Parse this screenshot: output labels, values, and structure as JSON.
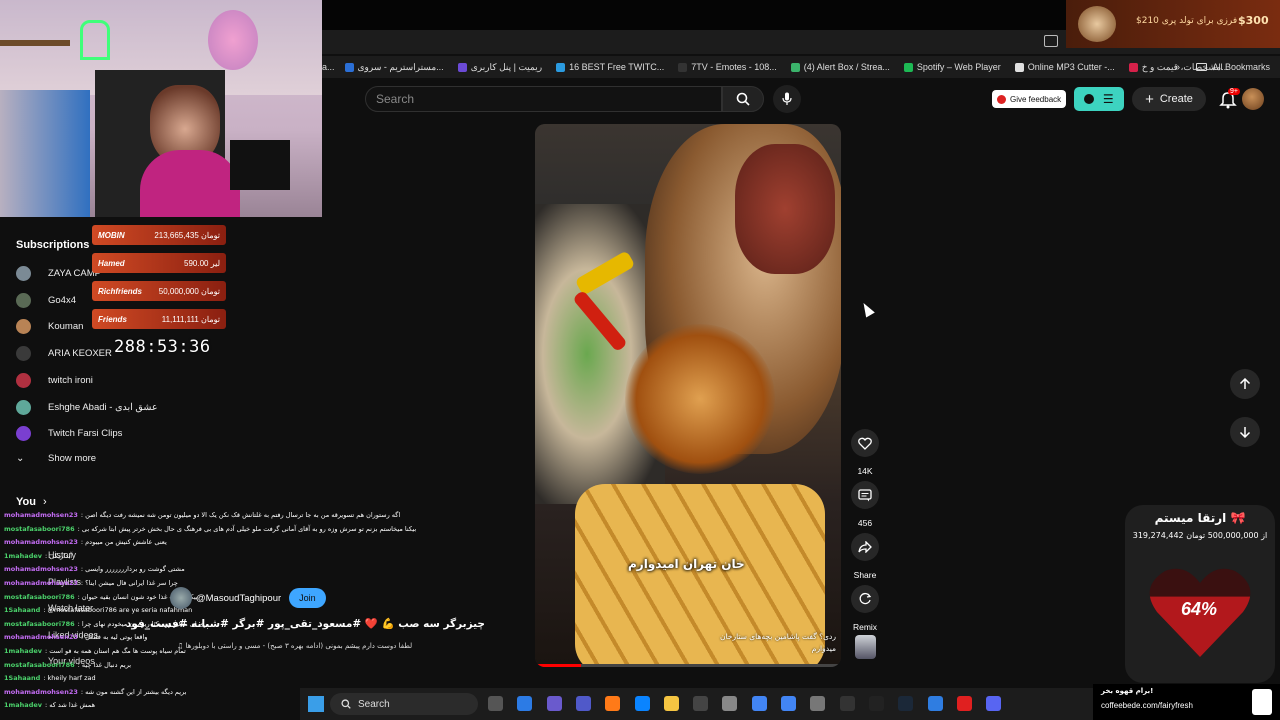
{
  "browser": {
    "bookmarks": [
      {
        "label": "مستراستریم - سروی...",
        "color": "#2b6fd6"
      },
      {
        "label": "ریمیت | پنل کاربری",
        "color": "#6b4ad6"
      },
      {
        "label": "16 BEST Free TWITC...",
        "color": "#2b9be0"
      },
      {
        "label": "7TV - Emotes - 108...",
        "color": "#333333"
      },
      {
        "label": "(4) Alert Box / Strea...",
        "color": "#3bb36b"
      },
      {
        "label": "Spotify – Web Player",
        "color": "#1db954"
      },
      {
        "label": "Online MP3 Cutter -...",
        "color": "#e0e0e0"
      },
      {
        "label": "مشخصات، قیمت و خ...",
        "color": "#d6214a"
      }
    ],
    "all_bookmarks": "All Bookmarks"
  },
  "header": {
    "search_placeholder": "Search",
    "feedback_label": "Give feedback",
    "create_label": "Create",
    "notif_count": "9+"
  },
  "sidebar": {
    "subscriptions_title": "Subscriptions",
    "subscriptions": [
      {
        "label": "ZAYA CAMP",
        "color": "#7b8a95"
      },
      {
        "label": "Go4x4",
        "color": "#5a6a55"
      },
      {
        "label": "Kouman",
        "color": "#b88355"
      },
      {
        "label": "ARIA KEOXER",
        "color": "#3a3a3a"
      },
      {
        "label": "twitch ironi",
        "color": "#b03040"
      },
      {
        "label": "Eshghe Abadi - عشق ابدی",
        "color": "#5fa89a"
      },
      {
        "label": "Twitch Farsi Clips",
        "color": "#7a3fd0"
      }
    ],
    "show_more": "Show more",
    "you_title": "You",
    "you_items": [
      "History",
      "Playlists",
      "Watch later",
      "Liked videos",
      "Your videos"
    ]
  },
  "stream_overlay": {
    "donations": [
      {
        "name": "MOBIN",
        "amount": "213,665,435 تومان"
      },
      {
        "name": "Hamed",
        "amount": "590.00 لیر"
      },
      {
        "name": "Richfriends",
        "amount": "50,000,000 تومان"
      },
      {
        "name": "Friends",
        "amount": "11,111,111 تومان"
      }
    ],
    "timer": "288:53:36",
    "top_widget_text": "$210 فرزی برای تولد پری",
    "top_widget_amount": "$300"
  },
  "chat": [
    {
      "user": "mohamadmohsen23",
      "msg": ": اگه رستوران هم تسویرقه من به جا ترسال رفتم به غلتانش قک نکن یک الا دو میلیون تومن شه نمیشه رفت دیگه اصن",
      "green": false
    },
    {
      "user": "mostafasaboori786",
      "msg": ": بیکنا میخاستم بزنم تو سرش وزه رو به آقای آمانی گرفت ملو خیلی آدم های بی فرهنگ ی حال بخش خرتر پیش ابتا شرکه بی",
      "green": true
    },
    {
      "user": "mohamadmohsen23",
      "msg": ": یعنی عاشش کنیش من میبودم",
      "green": false
    },
    {
      "user": "1mahadev",
      "msg": ": آبداریکی",
      "green": true
    },
    {
      "user": "mohamadmohsen23",
      "msg": ": مشتی گوشت رو برداررررررر وایسی",
      "green": false
    },
    {
      "user": "mohamadmohsen23",
      "msg": ": چرا سر غذا ایرانی فال میشن اینا؟",
      "green": false
    },
    {
      "user": "mostafasaboori786",
      "msg": ": بیکا آقا آپ غذا خود شون انسان بقیه حیوان",
      "green": true
    },
    {
      "user": "1Sahaand",
      "msg": ": @mostafasaboori786 are ye seria nafahman",
      "green": true
    },
    {
      "user": "mostafasaboori786",
      "msg": ": ری ای میکیو رو بیکنا ریو بون میخودم نهای چرا",
      "green": true
    },
    {
      "user": "mohamadmohsen23",
      "msg": ": واقعا پوتی لیه به فلنکل",
      "green": false
    },
    {
      "user": "1mahadev",
      "msg": ": تمام سیاه پوست ها مگ هم استان همه به فو است",
      "green": true
    },
    {
      "user": "mostafasaboori786",
      "msg": ": بریم دنبال غذا چیه",
      "green": true
    },
    {
      "user": "1Sahaand",
      "msg": ": kheily harf zad",
      "green": true
    },
    {
      "user": "mohamadmohsen23",
      "msg": ": بریم دیگه بیشتر از این گشنه مون شه",
      "green": false
    },
    {
      "user": "1mahadev",
      "msg": ": همش غذا شد که",
      "green": true
    }
  ],
  "video": {
    "overlay_caption": "خان تهران امیدوارم",
    "small_caption_1": "ردی؟ گفت پاشامین بچه‌های ستارخان",
    "small_caption_2": "میدوارم",
    "channel": "@MasoudTaghipour",
    "join_label": "Join",
    "title": "چیزبرگر سه صب 💪 ❤️ #مسعود_تقی_پور #برگر #شبانه #فست_فود",
    "audio": "♫ لطفا دوست دارم پیشم بمونی (ادامه بهره ۳ صبح) - مسی و راستی با دوبلورها",
    "progress": 0.15
  },
  "actions": {
    "likes": "14K",
    "comments": "456",
    "share": "Share",
    "remix": "Remix"
  },
  "goal": {
    "title": "ارتقا میستم 🎀",
    "amount": "319,274,442 از 500,000,000 تومان",
    "percent_label": "64%",
    "percent": 0.64
  },
  "promo": {
    "line1": "برام قهوه بخر!",
    "line2": "coffeebede.com/fairyfresh"
  },
  "taskbar": {
    "search_label": "Search",
    "icons": [
      "windows-icon",
      "files-icon",
      "copilot-icon",
      "teams-icon",
      "firefox-icon",
      "edge-icon",
      "explorer-icon",
      "store-icon",
      "app-icon",
      "chrome-icon",
      "chrome-2-icon",
      "settings-icon",
      "obs-icon",
      "media-icon",
      "steam-icon",
      "vscode-icon",
      "vivaldi-icon",
      "discord-icon"
    ]
  },
  "colors": {
    "accent_blue": "#3ea6ff",
    "youtube_red": "#ff0000",
    "donation_red": "#c0391b"
  }
}
